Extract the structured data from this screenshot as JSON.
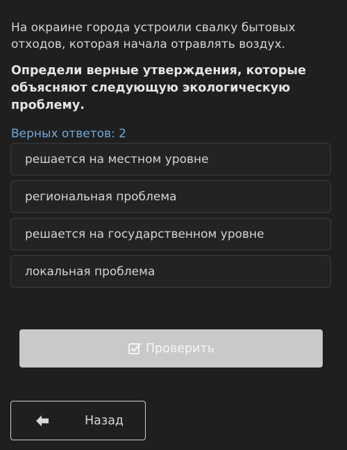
{
  "task": {
    "intro": "На окраине города устроили свалку бытовых отходов, которая начала отравлять воздух.",
    "question": "Определи верные утверждения, которые объясняют следующую экологическую проблему.",
    "hint": "Верных ответов: 2"
  },
  "options": [
    {
      "label": "решается на местном уровне"
    },
    {
      "label": "региональная проблема"
    },
    {
      "label": "решается на государственном уровне"
    },
    {
      "label": "локальная проблема"
    }
  ],
  "actions": {
    "check_label": "Проверить",
    "check_icon": "checkbox-check-icon",
    "back_label": "Назад",
    "back_icon": "arrow-left-icon"
  },
  "colors": {
    "background": "#1f1f1f",
    "hint": "#6fa8dc",
    "check_button": "#c9c9c9"
  }
}
